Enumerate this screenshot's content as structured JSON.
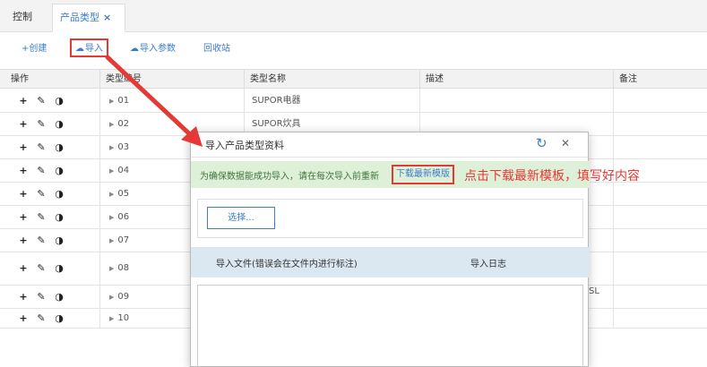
{
  "tabs": [
    {
      "label": "控制台"
    },
    {
      "label": "产品类型",
      "close": "×"
    }
  ],
  "toolbar": {
    "create": "+创建",
    "import": "导入",
    "import_params": "导入参数",
    "recycle": "回收站"
  },
  "columns": [
    "操作",
    "类型编号",
    "类型名称",
    "描述",
    "备注"
  ],
  "rows": [
    {
      "code": "01",
      "name": "SUPOR电器"
    },
    {
      "code": "02",
      "name": "SUPOR炊具"
    },
    {
      "code": "03",
      "name": ""
    },
    {
      "code": "04",
      "name": ""
    },
    {
      "code": "05",
      "name": ""
    },
    {
      "code": "06",
      "name": ""
    },
    {
      "code": "07",
      "name": ""
    },
    {
      "code": "08",
      "name": ""
    },
    {
      "code": "09",
      "name": ""
    },
    {
      "code": "10",
      "name": ""
    }
  ],
  "bg_fragment": "SL",
  "modal": {
    "title": "导入产品类型资料",
    "notice": "为确保数据能成功导入，请在每次导入前重新",
    "download_link": "下载最新模版",
    "choose_button": "选择...",
    "col_file": "导入文件(错误会在文件内进行标注)",
    "col_log": "导入日志"
  },
  "annotation": "点击下载最新模板，填写好内容",
  "colors": {
    "accent": "#3b7dc9",
    "highlight": "#e53935",
    "notice_bg": "#dff0d8",
    "table_head_bg": "#dbe8f2"
  }
}
